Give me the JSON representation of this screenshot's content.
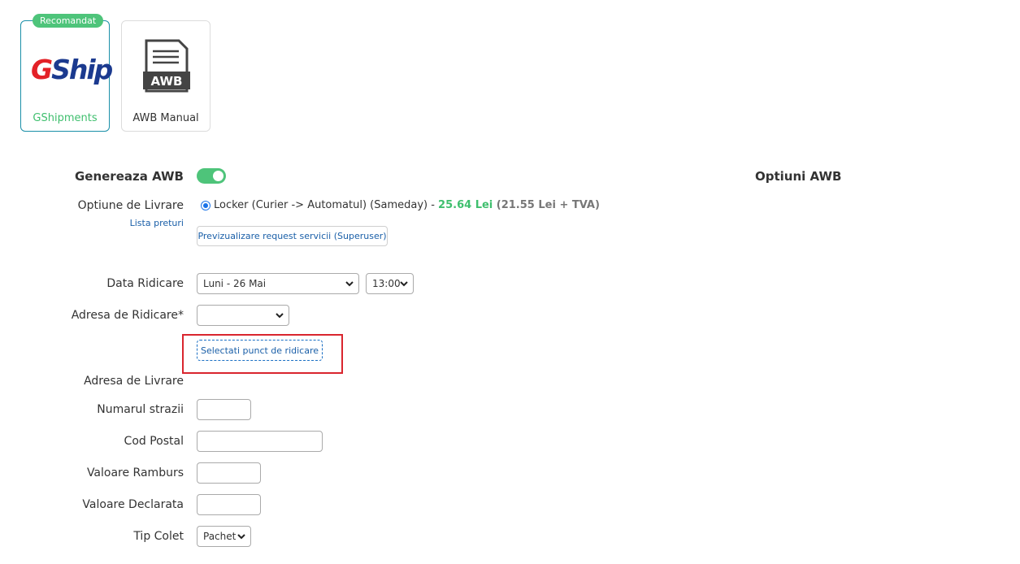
{
  "carriers": [
    {
      "name": "GShipments",
      "badge": "Recomandat",
      "logo_g": "G",
      "logo_rest": "Ship"
    },
    {
      "name": "AWB Manual",
      "icon_text": "AWB"
    }
  ],
  "form": {
    "generate_awb_label": "Genereaza AWB",
    "generate_awb_on": true,
    "options_title": "Optiuni AWB",
    "delivery_option_label": "Optiune de Livrare",
    "price_list_link": "Lista preturi",
    "delivery_option": {
      "text": "Locker (Curier -> Automatul) (Sameday) - ",
      "price": "25.64 Lei",
      "price_detail": " (21.55 Lei + TVA)"
    },
    "preview_request_button": "Previzualizare request servicii (Superuser)",
    "pickup_date_label": "Data Ridicare",
    "pickup_date_value": "Luni - 26 Mai",
    "pickup_time_value": "13:00",
    "pickup_address_label": "Adresa de Ridicare*",
    "pickup_address_value": "",
    "select_pickup_button": "Selectati punct de ridicare",
    "delivery_address_label": "Adresa de Livrare",
    "street_number_label": "Numarul strazii",
    "postal_code_label": "Cod Postal",
    "cod_value_label": "Valoare Ramburs",
    "declared_value_label": "Valoare Declarata",
    "package_type_label": "Tip Colet",
    "package_type_value": "Pachet"
  },
  "colors": {
    "accent_green": "#4ec47a",
    "link_blue": "#1a5fa8",
    "highlight_red": "#d9252e"
  }
}
